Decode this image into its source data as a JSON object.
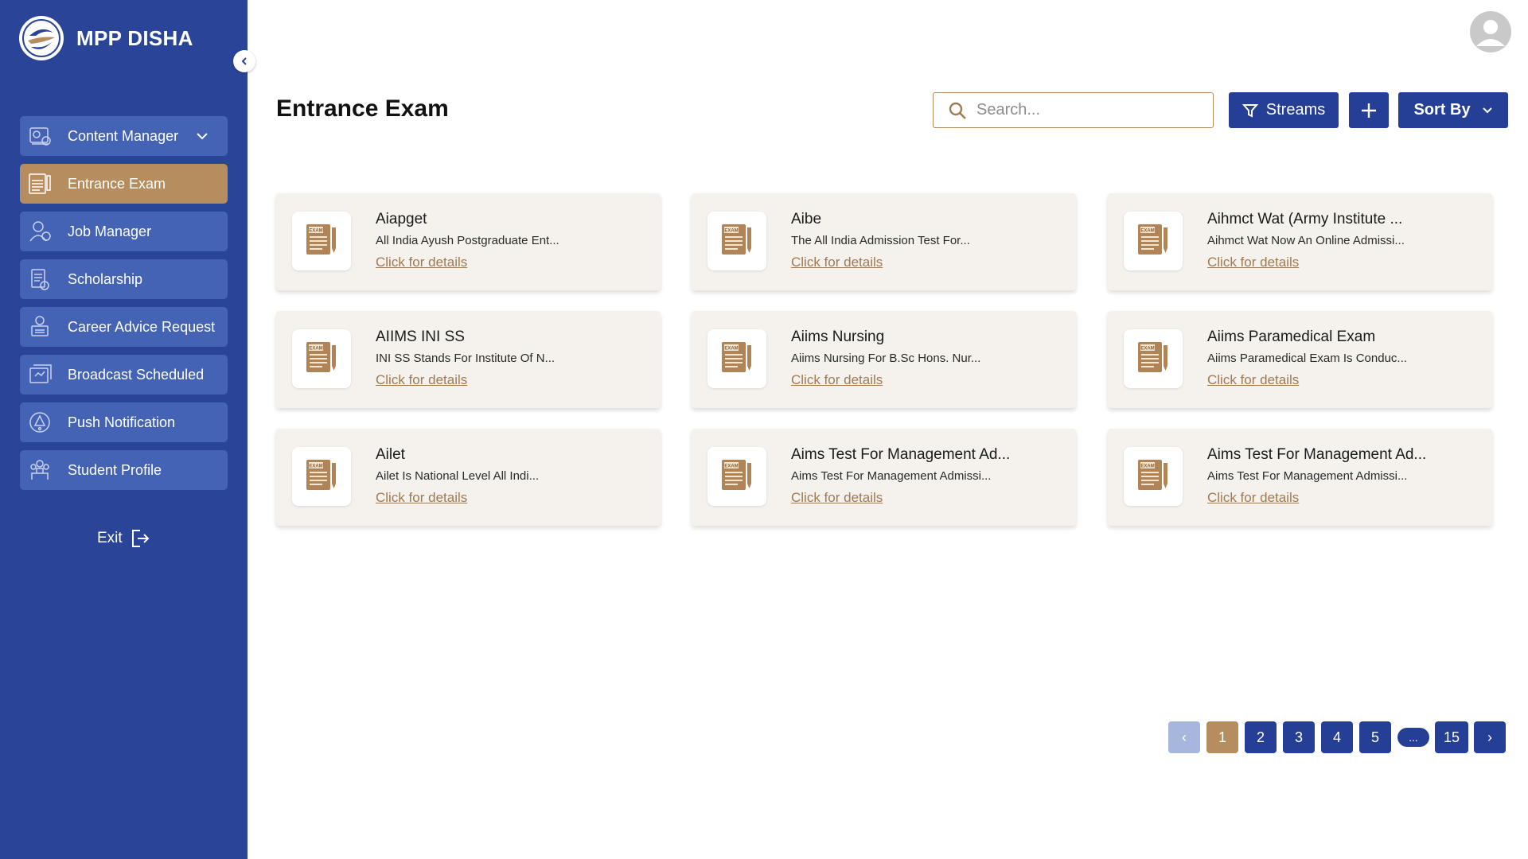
{
  "app": {
    "name": "MPP DISHA"
  },
  "sidebar": {
    "items": [
      {
        "label": "Content Manager",
        "icon": "content-manager-icon",
        "has_dropdown": true,
        "active": false
      },
      {
        "label": "Entrance Exam",
        "icon": "exam-icon",
        "active": true
      },
      {
        "label": "Job Manager",
        "icon": "job-manager-icon",
        "active": false
      },
      {
        "label": "Scholarship",
        "icon": "scholarship-icon",
        "active": false
      },
      {
        "label": "Career Advice Request",
        "icon": "career-advice-icon",
        "active": false
      },
      {
        "label": "Broadcast Scheduled",
        "icon": "broadcast-icon",
        "active": false
      },
      {
        "label": "Push Notification",
        "icon": "push-notification-icon",
        "active": false
      },
      {
        "label": "Student Profile",
        "icon": "student-profile-icon",
        "active": false
      }
    ],
    "exit_label": "Exit"
  },
  "header": {
    "title": "Entrance Exam",
    "search_placeholder": "Search...",
    "streams_label": "Streams",
    "add_label": "+",
    "sort_label": "Sort By"
  },
  "cards": [
    {
      "title": "Aiapget",
      "desc": "All India Ayush Postgraduate Ent...",
      "link": "Click for details"
    },
    {
      "title": "Aibe",
      "desc": "The All India Admission Test For...",
      "link": "Click for details"
    },
    {
      "title": "Aihmct Wat (Army Institute ...",
      "desc": "Aihmct Wat Now An Online Admissi...",
      "link": "Click for details"
    },
    {
      "title": "AIIMS INI SS",
      "desc": "INI SS Stands For Institute Of N...",
      "link": "Click for details"
    },
    {
      "title": "Aiims Nursing",
      "desc": "Aiims Nursing For B.Sc Hons. Nur...",
      "link": "Click for details"
    },
    {
      "title": "Aiims Paramedical Exam",
      "desc": "Aiims Paramedical Exam Is Conduc...",
      "link": "Click for details"
    },
    {
      "title": "Ailet",
      "desc": "Ailet Is National Level All Indi...",
      "link": "Click for details"
    },
    {
      "title": "Aims Test For Management Ad...",
      "desc": "Aims Test For Management Admissi...",
      "link": "Click for details"
    },
    {
      "title": "Aims Test For Management Ad...",
      "desc": "Aims Test For Management Admissi...",
      "link": "Click for details"
    }
  ],
  "pagination": {
    "prev": "‹",
    "pages": [
      "1",
      "2",
      "3",
      "4",
      "5"
    ],
    "ellipsis": "...",
    "last": "15",
    "next": "›",
    "current": "1"
  },
  "colors": {
    "sidebar_bg": "#2a4497",
    "nav_item_bg": "#4563b5",
    "accent_gold": "#b68d5e",
    "button_blue": "#243f95",
    "card_bg": "#f5f2ee"
  }
}
